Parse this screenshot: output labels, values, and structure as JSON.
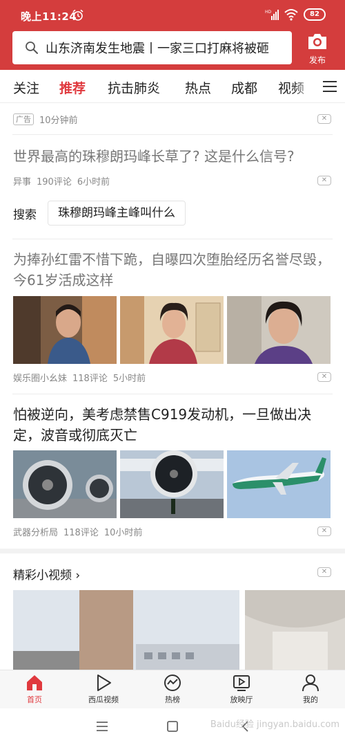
{
  "status_bar": {
    "time": "晚上11:24",
    "battery": "82",
    "signal": "HD"
  },
  "search": {
    "query": "山东济南发生地震丨一家三口打麻将被砸",
    "publish_label": "发布"
  },
  "tabs": [
    {
      "label": "关注",
      "active": false
    },
    {
      "label": "推荐",
      "active": true
    },
    {
      "label": "抗击肺炎",
      "active": false
    },
    {
      "label": "热点",
      "active": false
    },
    {
      "label": "成都",
      "active": false
    },
    {
      "label": "视频",
      "active": false
    }
  ],
  "feed": {
    "ad": {
      "badge": "广告",
      "time": "10分钟前"
    },
    "article1": {
      "title": "世界最高的珠穆朗玛峰长草了? 这是什么信号?",
      "source": "异事",
      "comments": "190评论",
      "time": "6小时前"
    },
    "related_search": {
      "label": "搜索",
      "query": "珠穆朗玛峰主峰叫什么"
    },
    "article2": {
      "title": "为捧孙红雷不惜下跪，自曝四次堕胎经历名誉尽毁，今61岁活成这样",
      "source": "娱乐圈小幺妹",
      "comments": "118评论",
      "time": "5小时前"
    },
    "article3": {
      "title": "怕被逆向，美考虑禁售C919发动机，一旦做出决定，波音或彻底灭亡",
      "source": "武器分析局",
      "comments": "118评论",
      "time": "10小时前"
    },
    "video_section": {
      "title": "精彩小视频",
      "chevron": "›"
    }
  },
  "bottom_nav": [
    {
      "label": "首页",
      "icon": "home-icon",
      "active": true
    },
    {
      "label": "西瓜视频",
      "icon": "play-icon",
      "active": false
    },
    {
      "label": "热榜",
      "icon": "trending-icon",
      "active": false
    },
    {
      "label": "放映厅",
      "icon": "tv-icon",
      "active": false
    },
    {
      "label": "我的",
      "icon": "user-icon",
      "active": false
    }
  ],
  "watermark": "Baidu经验 jingyan.baidu.com",
  "colors": {
    "brand_red": "#d43d3d",
    "active_tab": "#e0393e",
    "meta_gray": "#888888"
  }
}
